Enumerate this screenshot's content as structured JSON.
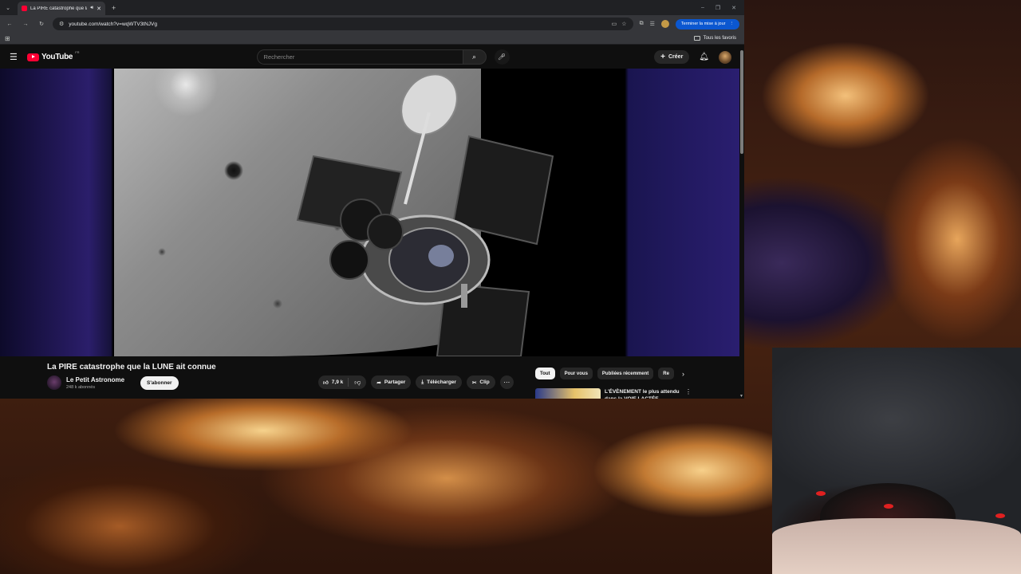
{
  "browser": {
    "tab": {
      "title": "La PIRE catastrophe que la",
      "audio_icon": "speaker-icon",
      "close_label": "✕"
    },
    "new_tab_label": "+",
    "url": "youtube.com/watch?v=wqWTV3tNJVg",
    "update_button": "Terminer la mise à jour",
    "bookmarks": {
      "all_label": "Tous les favoris"
    }
  },
  "youtube": {
    "logo_text": "YouTube",
    "country_code": "FR",
    "search": {
      "placeholder": "Rechercher"
    },
    "create_label": "Créer",
    "video": {
      "title": "La PIRE catastrophe que la LUNE ait connue",
      "channel": "Le Petit Astronome",
      "subscribers": "248 k abonnés",
      "subscribe_label": "S'abonner",
      "likes": "7,9 k",
      "share_label": "Partager",
      "download_label": "Télécharger",
      "clip_label": "Clip"
    },
    "chips": [
      "Tout",
      "Pour vous",
      "Publiées récemment",
      "Re"
    ],
    "recommendation": {
      "title": "L'ÉVÈNEMENT le plus attendu dans la VOIE LACTÉE"
    }
  },
  "colors": {
    "youtube_red": "#ff0033",
    "update_blue": "#0b57d0",
    "page_bg": "#0f0f0f"
  }
}
